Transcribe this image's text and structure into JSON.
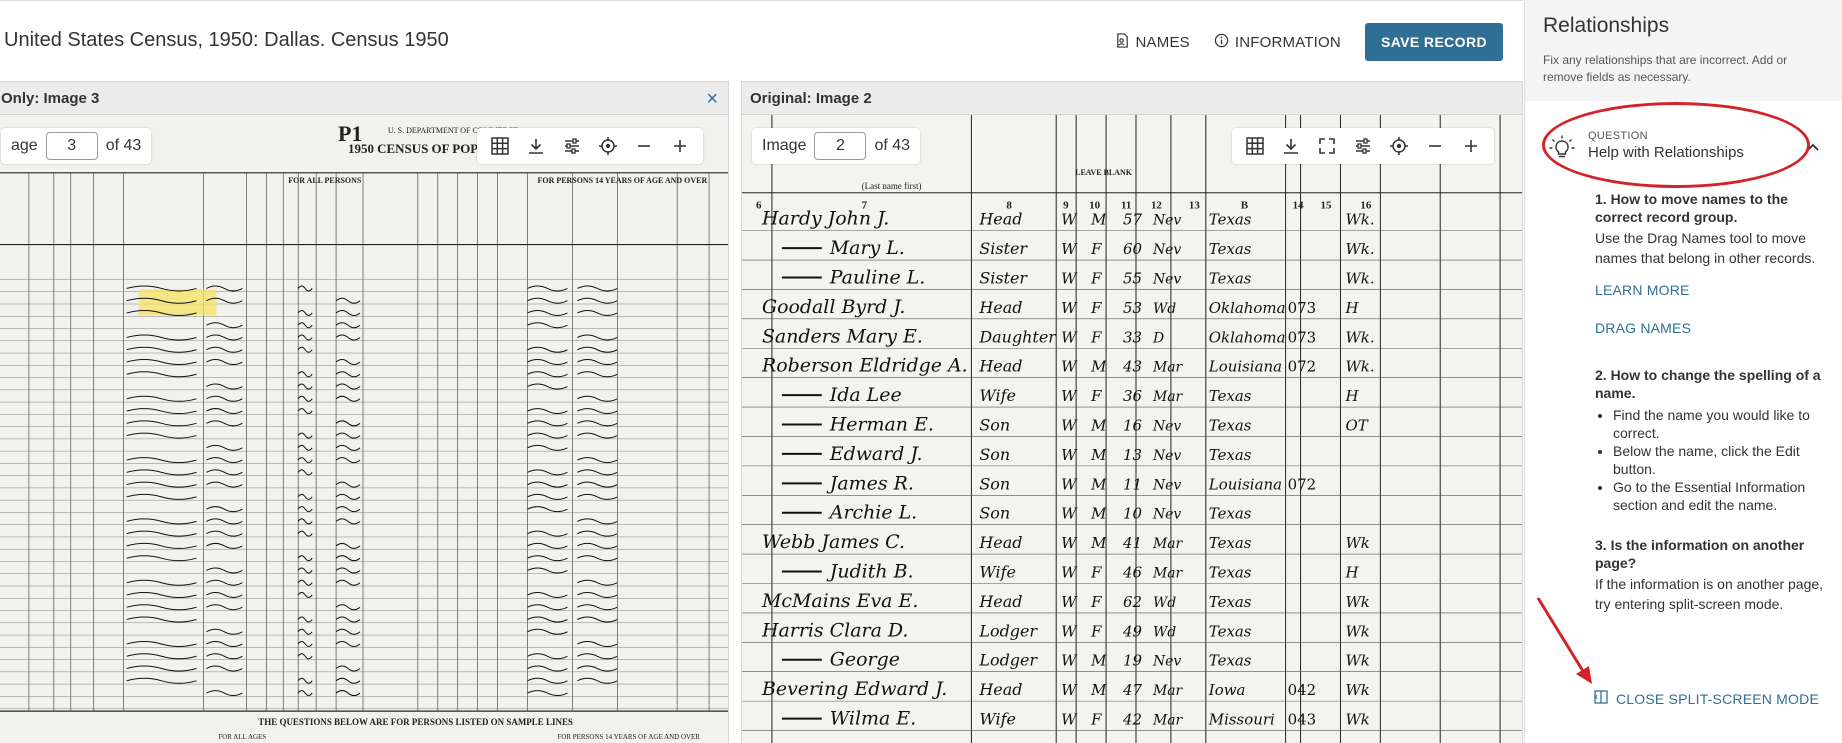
{
  "header": {
    "title": "United States Census, 1950: Dallas. Census 1950",
    "names_label": "NAMES",
    "information_label": "INFORMATION",
    "save_label": "SAVE RECORD"
  },
  "left_viewer": {
    "heading": "Only: Image 3",
    "page_label": "age",
    "page_value": "3",
    "page_total": "of 43"
  },
  "right_viewer": {
    "heading": "Original: Image 2",
    "page_label": "Image",
    "page_value": "2",
    "page_total": "of 43"
  },
  "left_scan": {
    "form_title": "1950 CENSUS OF POPU",
    "form_id": "P1",
    "dept": "U. S. DEPARTMENT OF COMMERCE",
    "section_all": "FOR ALL PERSONS",
    "section_14": "FOR PERSONS 14 YEARS OF AGE AND OVER",
    "footer": "THE QUESTIONS BELOW ARE FOR PERSONS LISTED ON SAMPLE LINES",
    "footer_left": "FOR ALL AGES",
    "footer_right": "FOR PERSONS 14 YEARS OF AGE AND OVER"
  },
  "right_scan": {
    "columns": [
      "6",
      "7",
      "8",
      "9",
      "10",
      "11",
      "12",
      "13",
      "B",
      "14",
      "15",
      "16"
    ],
    "header_note": "(Last name first)",
    "leave_blank": "LEAVE BLANK",
    "rows": [
      [
        "Hardy John J.",
        "Head",
        "W",
        "M",
        "57",
        "Nev",
        "Texas",
        "",
        "Wk."
      ],
      [
        "Mary L.",
        "Sister",
        "W",
        "F",
        "60",
        "Nev",
        "Texas",
        "",
        "Wk."
      ],
      [
        "Pauline L.",
        "Sister",
        "W",
        "F",
        "55",
        "Nev",
        "Texas",
        "",
        "Wk."
      ],
      [
        "Goodall Byrd J.",
        "Head",
        "W",
        "F",
        "53",
        "Wd",
        "Oklahoma",
        "073",
        "H"
      ],
      [
        "Sanders Mary E.",
        "Daughter",
        "W",
        "F",
        "33",
        "D",
        "Oklahoma",
        "073",
        "Wk."
      ],
      [
        "Roberson Eldridge A.",
        "Head",
        "W",
        "M",
        "43",
        "Mar",
        "Louisiana",
        "072",
        "Wk."
      ],
      [
        "Ida Lee",
        "Wife",
        "W",
        "F",
        "36",
        "Mar",
        "Texas",
        "",
        "H"
      ],
      [
        "Herman E.",
        "Son",
        "W",
        "M",
        "16",
        "Nev",
        "Texas",
        "",
        "OT"
      ],
      [
        "Edward J.",
        "Son",
        "W",
        "M",
        "13",
        "Nev",
        "Texas",
        "",
        ""
      ],
      [
        "James R.",
        "Son",
        "W",
        "M",
        "11",
        "Nev",
        "Louisiana",
        "072",
        ""
      ],
      [
        "Archie L.",
        "Son",
        "W",
        "M",
        "10",
        "Nev",
        "Texas",
        "",
        ""
      ],
      [
        "Webb James C.",
        "Head",
        "W",
        "M",
        "41",
        "Mar",
        "Texas",
        "",
        "Wk"
      ],
      [
        "Judith B.",
        "Wife",
        "W",
        "F",
        "46",
        "Mar",
        "Texas",
        "",
        "H"
      ],
      [
        "McMains Eva E.",
        "Head",
        "W",
        "F",
        "62",
        "Wd",
        "Texas",
        "",
        "Wk"
      ],
      [
        "Harris Clara D.",
        "Lodger",
        "W",
        "F",
        "49",
        "Wd",
        "Texas",
        "",
        "Wk"
      ],
      [
        "George",
        "Lodger",
        "W",
        "M",
        "19",
        "Nev",
        "Texas",
        "",
        "Wk"
      ],
      [
        "Bevering Edward J.",
        "Head",
        "W",
        "M",
        "47",
        "Mar",
        "Iowa",
        "042",
        "Wk"
      ],
      [
        "Wilma E.",
        "Wife",
        "W",
        "F",
        "42",
        "Mar",
        "Missouri",
        "043",
        "Wk"
      ]
    ]
  },
  "sidebar": {
    "title": "Relationships",
    "description": "Fix any relationships that are incorrect. Add or remove fields as necessary.",
    "question_label": "QUESTION",
    "question_text": "Help with Relationships",
    "step1_title": "1. How to move names to the correct record group.",
    "step1_body": "Use the Drag Names tool to move names that belong in other records.",
    "learn_more": "LEARN MORE",
    "drag_names": "DRAG NAMES",
    "step2_title": "2. How to change the spelling of a name.",
    "step2_items": [
      "Find the name you would like to correct.",
      "Below the name, click the Edit button.",
      "Go to the Essential Information section and edit the name."
    ],
    "step3_title": "3. Is the information on another page?",
    "step3_body": "If the information is on another page, try entering split-screen mode.",
    "close_split": "CLOSE SPLIT-SCREEN MODE"
  },
  "colors": {
    "accent": "#2f6f95",
    "annotation": "#d3232a",
    "highlight": "#f5e26a"
  },
  "icons": [
    "names-icon",
    "info-icon",
    "grid-icon",
    "download-icon",
    "fullscreen-icon",
    "adjust-icon",
    "locate-icon",
    "zoom-out-icon",
    "zoom-in-icon",
    "close-icon",
    "lightbulb-icon",
    "chevron-up-icon",
    "split-screen-icon"
  ]
}
